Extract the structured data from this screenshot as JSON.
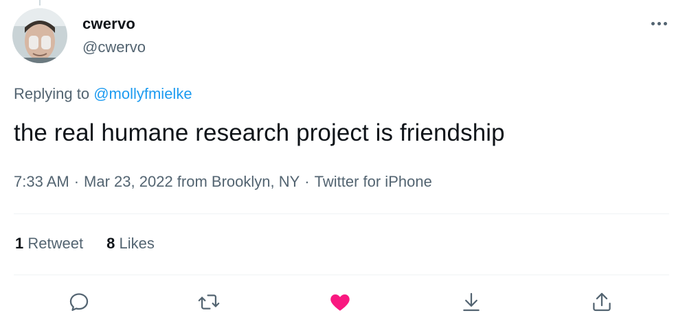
{
  "tweet": {
    "author": {
      "display_name": "cwervo",
      "handle": "@cwervo"
    },
    "replying_prefix": "Replying to",
    "replying_to": "@mollyfmielke",
    "text": "the real humane research project is friendship",
    "time": "7:33 AM",
    "separator": "·",
    "date_location": "Mar 23, 2022 from Brooklyn, NY",
    "source": "Twitter for iPhone",
    "stats": {
      "retweets_count": "1",
      "retweets_label": "Retweet",
      "likes_count": "8",
      "likes_label": "Likes"
    }
  },
  "icons": {
    "more": "more-dots-icon",
    "reply": "reply-bubble-icon",
    "retweet": "retweet-arrows-icon",
    "like": "heart-icon",
    "share": "share-down-arrow-icon",
    "upload": "upload-share-icon"
  },
  "colors": {
    "text_primary": "#0f1419",
    "text_secondary": "#536471",
    "link": "#1d9bf0",
    "like_active": "#f91880",
    "divider": "#eff3f4"
  }
}
